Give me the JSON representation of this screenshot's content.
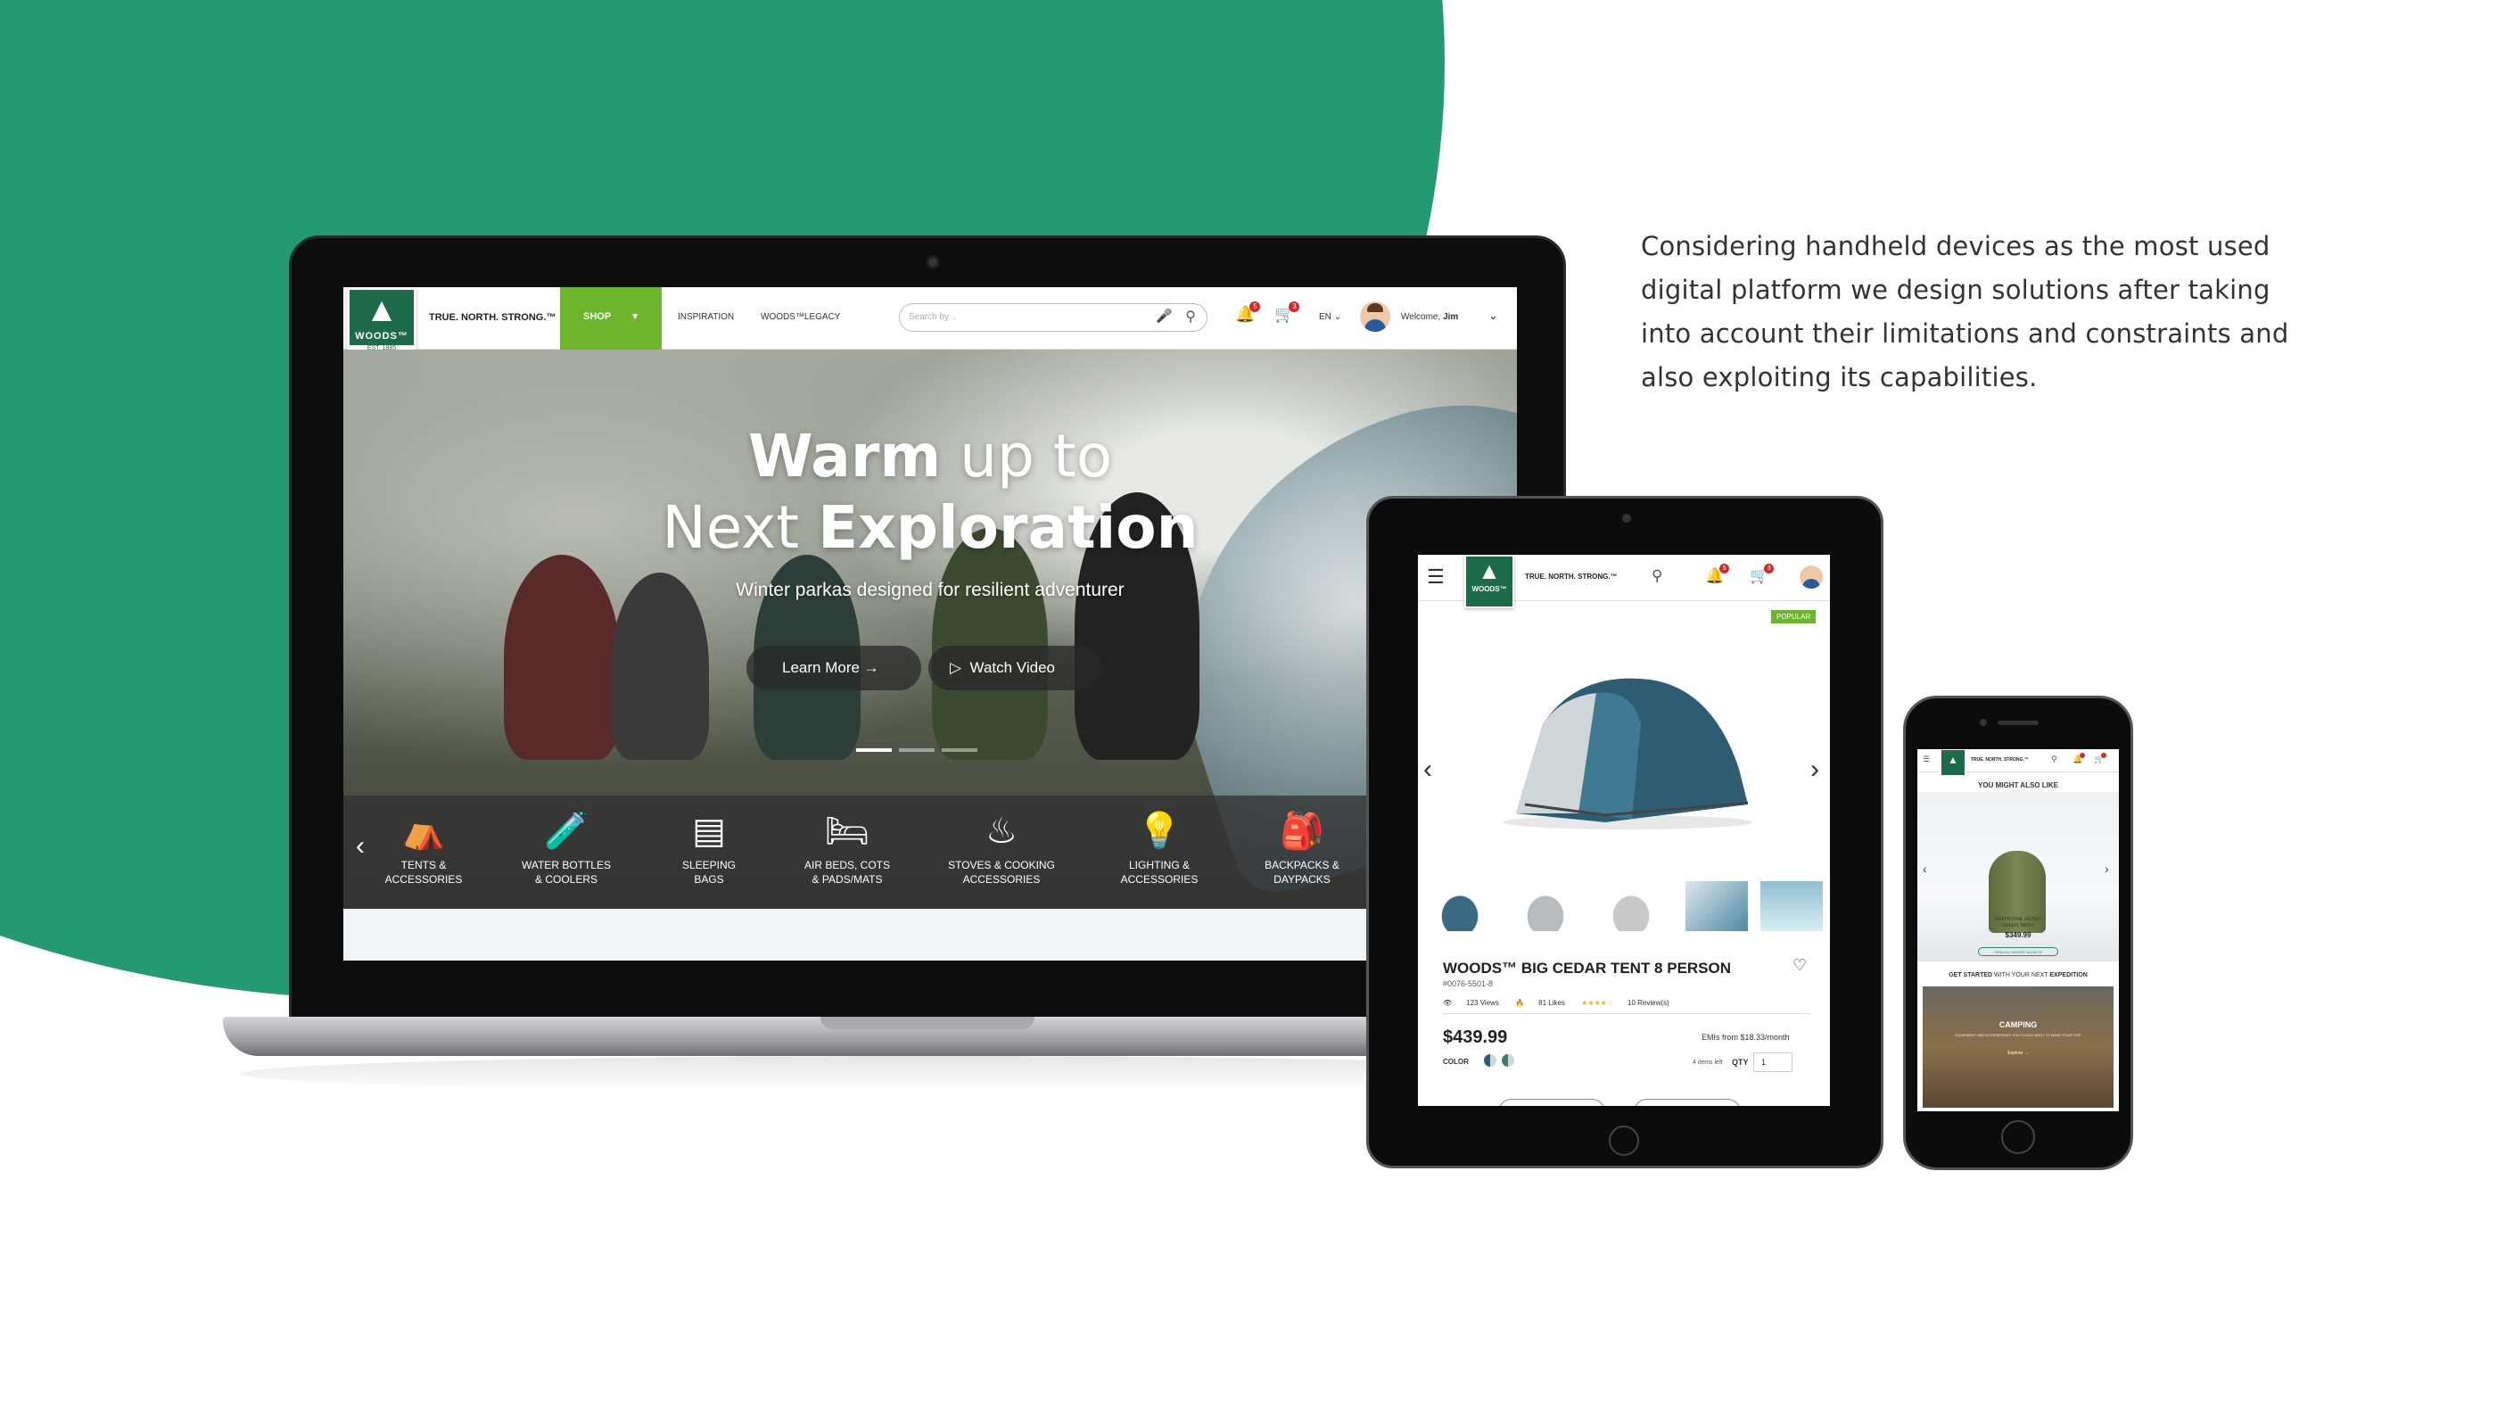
{
  "blurb": "Considering handheld devices as the most used digital platform we design solutions after taking into account their limitations and constraints and also exploiting its capabilities.",
  "brand": {
    "name": "WOODS™",
    "established": "EST. 1885",
    "tagline": "TRUE. NORTH. STRONG.™",
    "green": "#1e6b49",
    "accent": "#6cb52d",
    "background_green": "#239a6f"
  },
  "laptop": {
    "nav": {
      "shop": "SHOP",
      "inspiration": "INSPIRATION",
      "legacy": "WOODS™LEGACY",
      "search_placeholder": "Search by ..",
      "lang": "EN",
      "welcome": "Welcome,",
      "user": "Jim",
      "notif_count": "5",
      "cart_count": "3"
    },
    "hero": {
      "title_light_1": "Warm",
      "title_light_2": " up to",
      "title_light_3": "Next ",
      "title_bold": "Exploration",
      "subtitle": "Winter parkas designed for resilient  adventurer",
      "learn_more": "Learn More",
      "watch_video": "Watch Video"
    },
    "categories": [
      {
        "icon": "tent-icon",
        "line1": "TENTS &",
        "line2": "ACCESSORIES"
      },
      {
        "icon": "bottle-icon",
        "line1": "WATER BOTTLES",
        "line2": "& COOLERS"
      },
      {
        "icon": "sleeping-bag-icon",
        "line1": "SLEEPING",
        "line2": "BAGS"
      },
      {
        "icon": "air-bed-icon",
        "line1": "AIR BEDS, COTS",
        "line2": "& PADS/MATS"
      },
      {
        "icon": "stove-icon",
        "line1": "STOVES & COOKING",
        "line2": "ACCESSORIES"
      },
      {
        "icon": "bulb-icon",
        "line1": "LIGHTING &",
        "line2": "ACCESSORIES"
      },
      {
        "icon": "backpack-icon",
        "line1": "BACKPACKS &",
        "line2": "DAYPACKS"
      }
    ]
  },
  "tablet": {
    "badge": "POPULAR",
    "product_title": "WOODS™ BIG CEDAR TENT 8 PERSON",
    "sku": "#0076-5501-8",
    "views": "123 Views",
    "likes": "81 Likes",
    "reviews": "10 Review(s)",
    "price": "$439.99",
    "emi": "EMIs from $18.33/month",
    "color_label": "COLOR",
    "stock": "4 items left",
    "qty_label": "QTY",
    "qty_value": "1",
    "notif_count": "5",
    "cart_count": "3"
  },
  "phone": {
    "might_like": "YOU MIGHT ALSO LIKE",
    "product_name_1": "GREYSTONE JACKET",
    "product_name_2": "GREEN, MEN'S",
    "price": "$349.99",
    "view_all": "VIEW ALL WOODS JACKETS",
    "get_started_bold": "GET STARTED",
    "get_started_rest": " WITH YOUR NEXT ",
    "get_started_bold2": "EXPEDITION",
    "camping": "CAMPING",
    "camping_desc": "EQUIPMENT AND ACCESSORIES YOU COULD NEED TO MAKE YOUR TRIP",
    "explore": "Explore  →"
  }
}
